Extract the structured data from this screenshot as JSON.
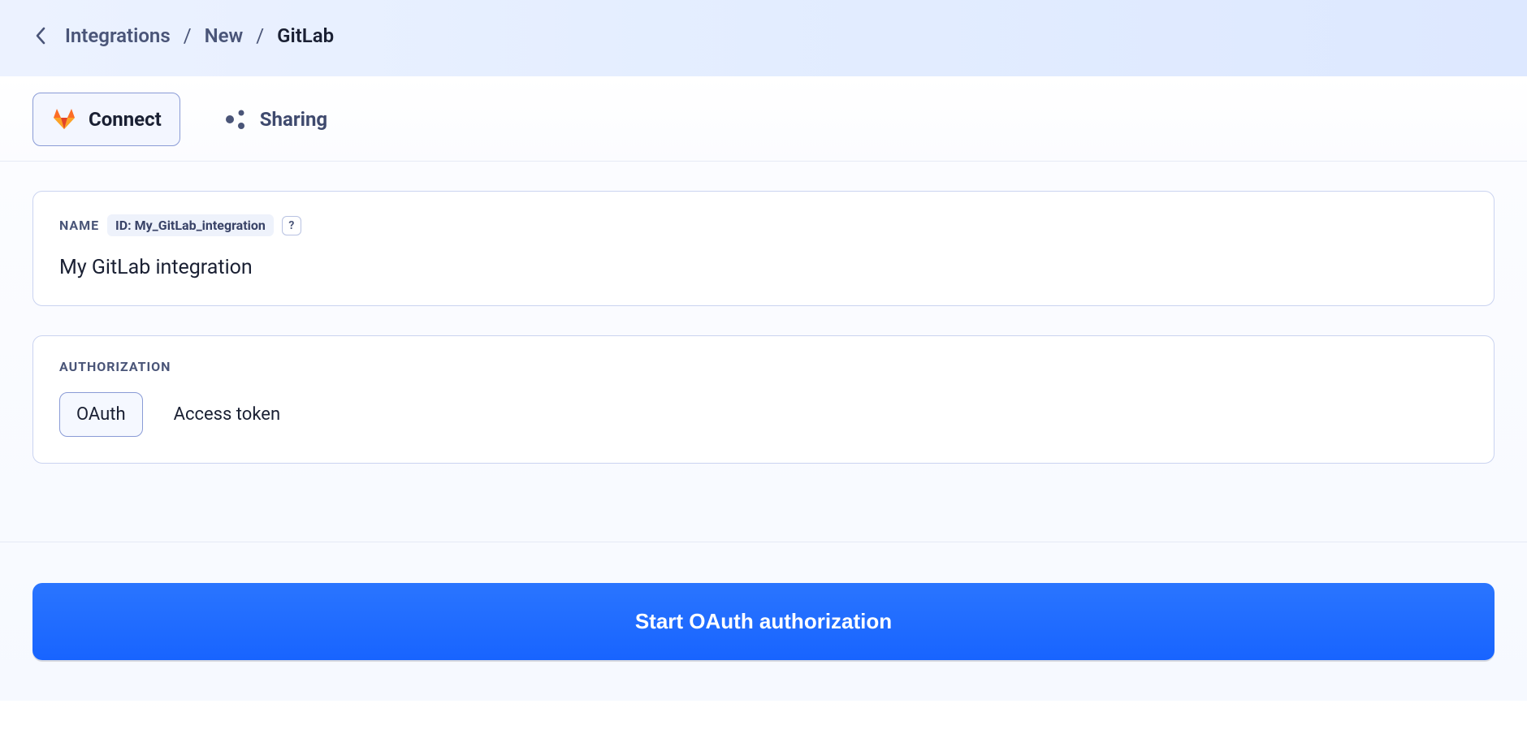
{
  "breadcrumb": {
    "items": [
      "Integrations",
      "New"
    ],
    "current": "GitLab",
    "separator": "/"
  },
  "tabs": {
    "connect": "Connect",
    "sharing": "Sharing"
  },
  "name_card": {
    "label": "NAME",
    "id_prefix": "ID:",
    "id_value": "My_GitLab_integration",
    "help_symbol": "?",
    "value": "My GitLab integration"
  },
  "auth_card": {
    "label": "AUTHORIZATION",
    "options": {
      "oauth": "OAuth",
      "token": "Access token"
    }
  },
  "cta": {
    "label": "Start OAuth authorization"
  }
}
